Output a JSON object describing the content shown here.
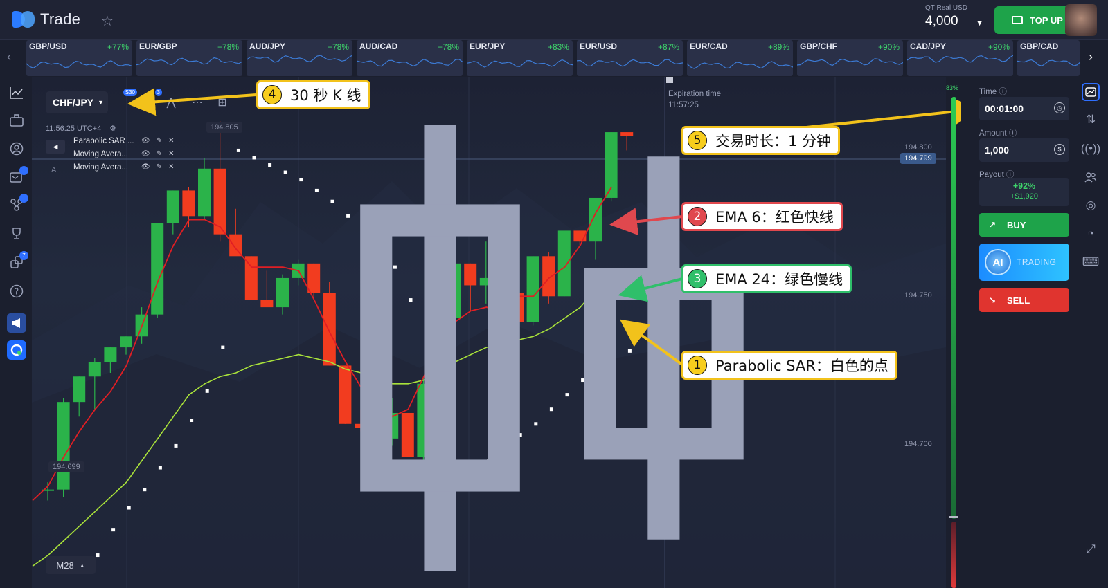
{
  "header": {
    "logo_text": "Trade",
    "account_label": "QT Real  USD",
    "balance": "4,000",
    "topup_label": "TOP UP"
  },
  "pairs": [
    {
      "name": "GBP/USD",
      "pct": "+77%"
    },
    {
      "name": "EUR/GBP",
      "pct": "+78%"
    },
    {
      "name": "AUD/JPY",
      "pct": "+78%"
    },
    {
      "name": "AUD/CAD",
      "pct": "+78%"
    },
    {
      "name": "EUR/JPY",
      "pct": "+83%"
    },
    {
      "name": "EUR/USD",
      "pct": "+87%"
    },
    {
      "name": "EUR/CAD",
      "pct": "+89%"
    },
    {
      "name": "GBP/CHF",
      "pct": "+90%"
    },
    {
      "name": "CAD/JPY",
      "pct": "+90%"
    },
    {
      "name": "GBP/CAD",
      "pct": ""
    }
  ],
  "leftbar_badges": {
    "chat": "",
    "social": "",
    "referral": "7"
  },
  "chart": {
    "asset": "CHF/JPY",
    "timeframe_badge": "S30",
    "drawing_badge": "3",
    "clock": "11:56:25 UTC+4",
    "indicators": [
      "Parabolic SAR ...",
      "Moving Avera...",
      "Moving Avera..."
    ],
    "high_tag": "194.805",
    "low_tag": "194.699",
    "axis": [
      "194.800",
      "194.750",
      "194.700"
    ],
    "current_price": "194.799",
    "expiration_label": "Expiration time",
    "expiration_time": "11:57:25",
    "zoom_label": "M28"
  },
  "chart_data": {
    "type": "candlestick",
    "candles_ohlc": [
      [
        194.702,
        194.704,
        194.699,
        194.702
      ],
      [
        194.702,
        194.727,
        194.7,
        194.726
      ],
      [
        194.726,
        194.733,
        194.722,
        194.733
      ],
      [
        194.733,
        194.738,
        194.724,
        194.737
      ],
      [
        194.737,
        194.741,
        194.734,
        194.741
      ],
      [
        194.741,
        194.744,
        194.739,
        194.744
      ],
      [
        194.744,
        194.752,
        194.742,
        194.75
      ],
      [
        194.75,
        194.775,
        194.749,
        194.775
      ],
      [
        194.775,
        194.784,
        194.772,
        194.784
      ],
      [
        194.784,
        194.785,
        194.774,
        194.777
      ],
      [
        194.777,
        194.793,
        194.776,
        194.79
      ],
      [
        194.79,
        194.803,
        194.77,
        194.772
      ],
      [
        194.772,
        194.779,
        194.768,
        194.766
      ],
      [
        194.766,
        194.766,
        194.754,
        194.754
      ],
      [
        194.754,
        194.762,
        194.752,
        194.752
      ],
      [
        194.752,
        194.761,
        194.75,
        194.76
      ],
      [
        194.76,
        194.765,
        194.758,
        194.764
      ],
      [
        194.764,
        194.764,
        194.754,
        194.756
      ],
      [
        194.756,
        194.759,
        194.736,
        194.736
      ],
      [
        194.736,
        194.736,
        194.72,
        194.72
      ],
      [
        194.72,
        194.724,
        194.718,
        194.719
      ],
      [
        194.719,
        194.72,
        194.716,
        194.716
      ],
      [
        194.716,
        194.727,
        194.714,
        194.723
      ],
      [
        194.723,
        194.723,
        194.711,
        194.711
      ],
      [
        194.711,
        194.733,
        194.705,
        194.731
      ],
      [
        194.731,
        194.758,
        194.73,
        194.749
      ],
      [
        194.749,
        194.764,
        194.744,
        194.764
      ],
      [
        194.764,
        194.764,
        194.751,
        194.758
      ],
      [
        194.758,
        194.77,
        194.753,
        194.76
      ],
      [
        194.76,
        194.766,
        194.756,
        194.756
      ],
      [
        194.756,
        194.756,
        194.748,
        194.748
      ],
      [
        194.748,
        194.766,
        194.747,
        194.766
      ],
      [
        194.766,
        194.767,
        194.753,
        194.755
      ],
      [
        194.755,
        194.766,
        194.755,
        194.773
      ],
      [
        194.773,
        194.773,
        194.769,
        194.77
      ],
      [
        194.77,
        194.778,
        194.765,
        194.782
      ],
      [
        194.782,
        194.8,
        194.781,
        194.8
      ],
      [
        194.8,
        194.8,
        194.795,
        194.799
      ]
    ],
    "ema_fast_red": [
      194.699,
      194.703,
      194.711,
      194.718,
      194.724,
      194.729,
      194.736,
      194.747,
      194.759,
      194.769,
      194.776,
      194.776,
      194.774,
      194.768,
      194.763,
      194.763,
      194.763,
      194.762,
      194.754,
      194.745,
      194.737,
      194.73,
      194.727,
      194.722,
      194.724,
      194.733,
      194.742,
      194.748,
      194.751,
      194.752,
      194.751,
      194.755,
      194.755,
      194.76,
      194.763,
      194.769,
      194.778,
      194.785
    ],
    "ema_slow_green": [
      194.681,
      194.684,
      194.688,
      194.692,
      194.696,
      194.7,
      194.704,
      194.71,
      194.716,
      194.722,
      194.728,
      194.731,
      194.733,
      194.734,
      194.736,
      194.737,
      194.738,
      194.739,
      194.738,
      194.737,
      194.735,
      194.734,
      194.733,
      194.731,
      194.731,
      194.732,
      194.735,
      194.737,
      194.739,
      194.741,
      194.742,
      194.743,
      194.744,
      194.746,
      194.749,
      194.752,
      194.757,
      194.762
    ],
    "sar_white": [
      194.684,
      194.691,
      194.697,
      194.702,
      194.708,
      194.714,
      194.721,
      194.729,
      194.741,
      194.795,
      194.793,
      194.791,
      194.789,
      194.787,
      194.784,
      194.781,
      194.777,
      194.773,
      194.768,
      194.763,
      194.754,
      194.741,
      194.705,
      194.705,
      194.707,
      194.71,
      194.713,
      194.717,
      194.72,
      194.724,
      194.728,
      194.732,
      194.735,
      194.738,
      194.74
    ],
    "ylim": [
      194.675,
      194.815
    ]
  },
  "annotations": {
    "a1_num": "1",
    "a1_text": "Parabolic SAR：白色的点",
    "a2_num": "2",
    "a2_text": "EMA 6：红色快线",
    "a3_num": "3",
    "a3_text": "EMA 24：绿色慢线",
    "a4_num": "4",
    "a4_text": "30 秒 K 线",
    "a5_num": "5",
    "a5_text": "交易时长：1 分钟"
  },
  "panel": {
    "slider_pct": "83%",
    "time_label": "Time",
    "time_value": "00:01:00",
    "amount_label": "Amount",
    "amount_value": "1,000",
    "payout_label": "Payout",
    "payout_pct": "+92%",
    "payout_amt": "+$1,920",
    "buy_label": "BUY",
    "ai_logo": "AI",
    "ai_label": "TRADING",
    "sell_label": "SELL"
  },
  "colors": {
    "up": "#2bb34a",
    "down": "#f23c1f",
    "ema_fast": "#e01e24",
    "ema_slow": "#a9e23a",
    "sar": "#ffffff"
  }
}
